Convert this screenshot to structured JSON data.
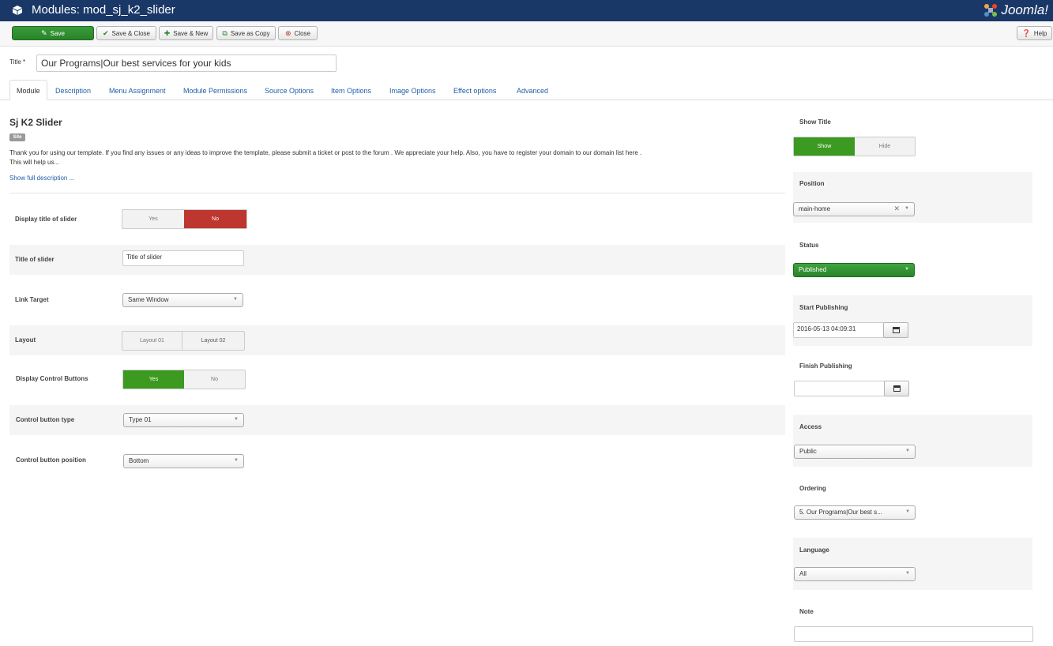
{
  "header": {
    "title": "Modules: mod_sj_k2_slider",
    "logo_text": "Joomla!"
  },
  "toolbar": {
    "save": "Save",
    "save_close": "Save & Close",
    "save_new": "Save & New",
    "save_copy": "Save as Copy",
    "close": "Close",
    "help": "Help"
  },
  "title_field": {
    "label": "Title *",
    "value": "Our Programs|Our best services for your kids"
  },
  "tabs": [
    "Module",
    "Description",
    "Menu Assignment",
    "Module Permissions",
    "Source Options",
    "Item Options",
    "Image Options",
    "Effect options",
    "Advanced"
  ],
  "module": {
    "heading": "Sj K2 Slider",
    "badge": "Site",
    "description_line1": "Thank you for using our template. If you find any issues or any ideas to improve the template, please submit a ticket or post to the forum . We appreciate your help. Also, you have to register your domain to our domain list here .",
    "description_line2": "This will help us...",
    "show_full": "Show full description ..."
  },
  "fields": {
    "display_title": {
      "label": "Display title of slider",
      "opt_yes": "Yes",
      "opt_no": "No",
      "selected": "No"
    },
    "title_of_slider": {
      "label": "Title of slider",
      "value": "Title of slider"
    },
    "link_target": {
      "label": "Link Target",
      "value": "Same Window"
    },
    "layout": {
      "label": "Layout",
      "opt1": "Layout 01",
      "opt2": "Layout 02"
    },
    "display_controls": {
      "label": "Display Control Buttons",
      "opt_yes": "Yes",
      "opt_no": "No",
      "selected": "Yes"
    },
    "control_type": {
      "label": "Control button type",
      "value": "Type 01"
    },
    "control_position": {
      "label": "Control button position",
      "value": "Bottom"
    }
  },
  "sidebar": {
    "show_title": {
      "label": "Show Title",
      "opt_show": "Show",
      "opt_hide": "Hide",
      "selected": "Show"
    },
    "position": {
      "label": "Position",
      "value": "main-home"
    },
    "status": {
      "label": "Status",
      "value": "Published"
    },
    "start_publishing": {
      "label": "Start Publishing",
      "value": "2016-05-13 04:09:31"
    },
    "finish_publishing": {
      "label": "Finish Publishing",
      "value": ""
    },
    "access": {
      "label": "Access",
      "value": "Public"
    },
    "ordering": {
      "label": "Ordering",
      "value": "5. Our Programs|Our best s..."
    },
    "language": {
      "label": "Language",
      "value": "All"
    },
    "note": {
      "label": "Note",
      "value": ""
    }
  },
  "colors": {
    "header": "#1a3867",
    "save": "#2f8f2f",
    "danger": "#bd362f",
    "success": "#3b9a1f",
    "link": "#1f5fa6"
  }
}
